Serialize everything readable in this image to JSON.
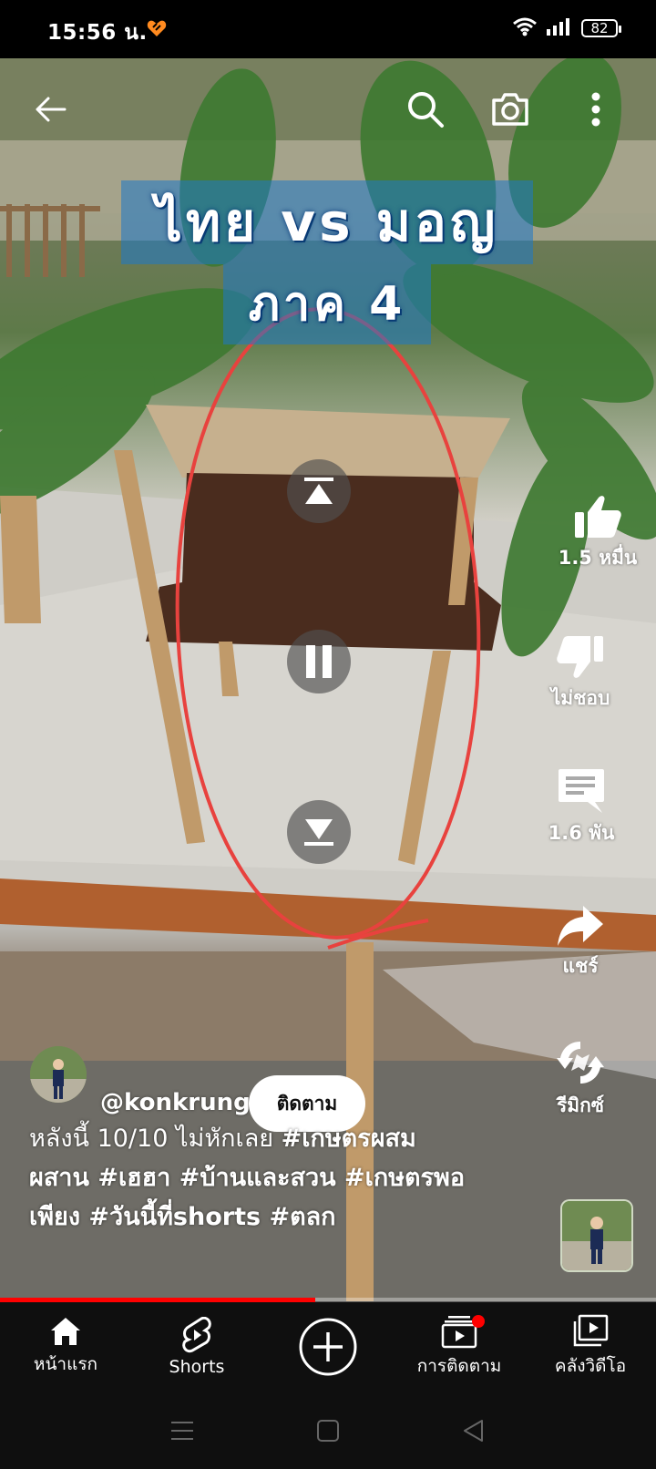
{
  "status_bar": {
    "time": "15:56 น.",
    "battery": "82"
  },
  "video": {
    "title_line1": "ไทย vs มอญ",
    "title_line2": "ภาค 4",
    "progress_fraction": 0.48
  },
  "actions": {
    "like_label": "1.5 หมื่น",
    "dislike_label": "ไม่ชอบ",
    "comment_label": "1.6 พัน",
    "share_label": "แชร์",
    "remix_label": "รีมิกซ์"
  },
  "channel": {
    "handle": "@konkrung",
    "subscribe_label": "ติดตาม"
  },
  "description": {
    "plain": "หลังนี้ 10/10 ไม่หักเลย ",
    "tags_line1": "#เกษตรผสม",
    "line2": "ผสาน #เฮฮา #บ้านและสวน #เกษตรพอ",
    "line3": "เพียง #วันนี้ที่shorts #ตลก"
  },
  "bottom_nav": {
    "home": "หน้าแรก",
    "shorts": "Shorts",
    "subscriptions": "การติดตาม",
    "library": "คลังวิดีโอ"
  },
  "colors": {
    "accent_red": "#ff0000",
    "annotation_red": "#e8423e",
    "title_box_blue": "#1e78c8"
  }
}
